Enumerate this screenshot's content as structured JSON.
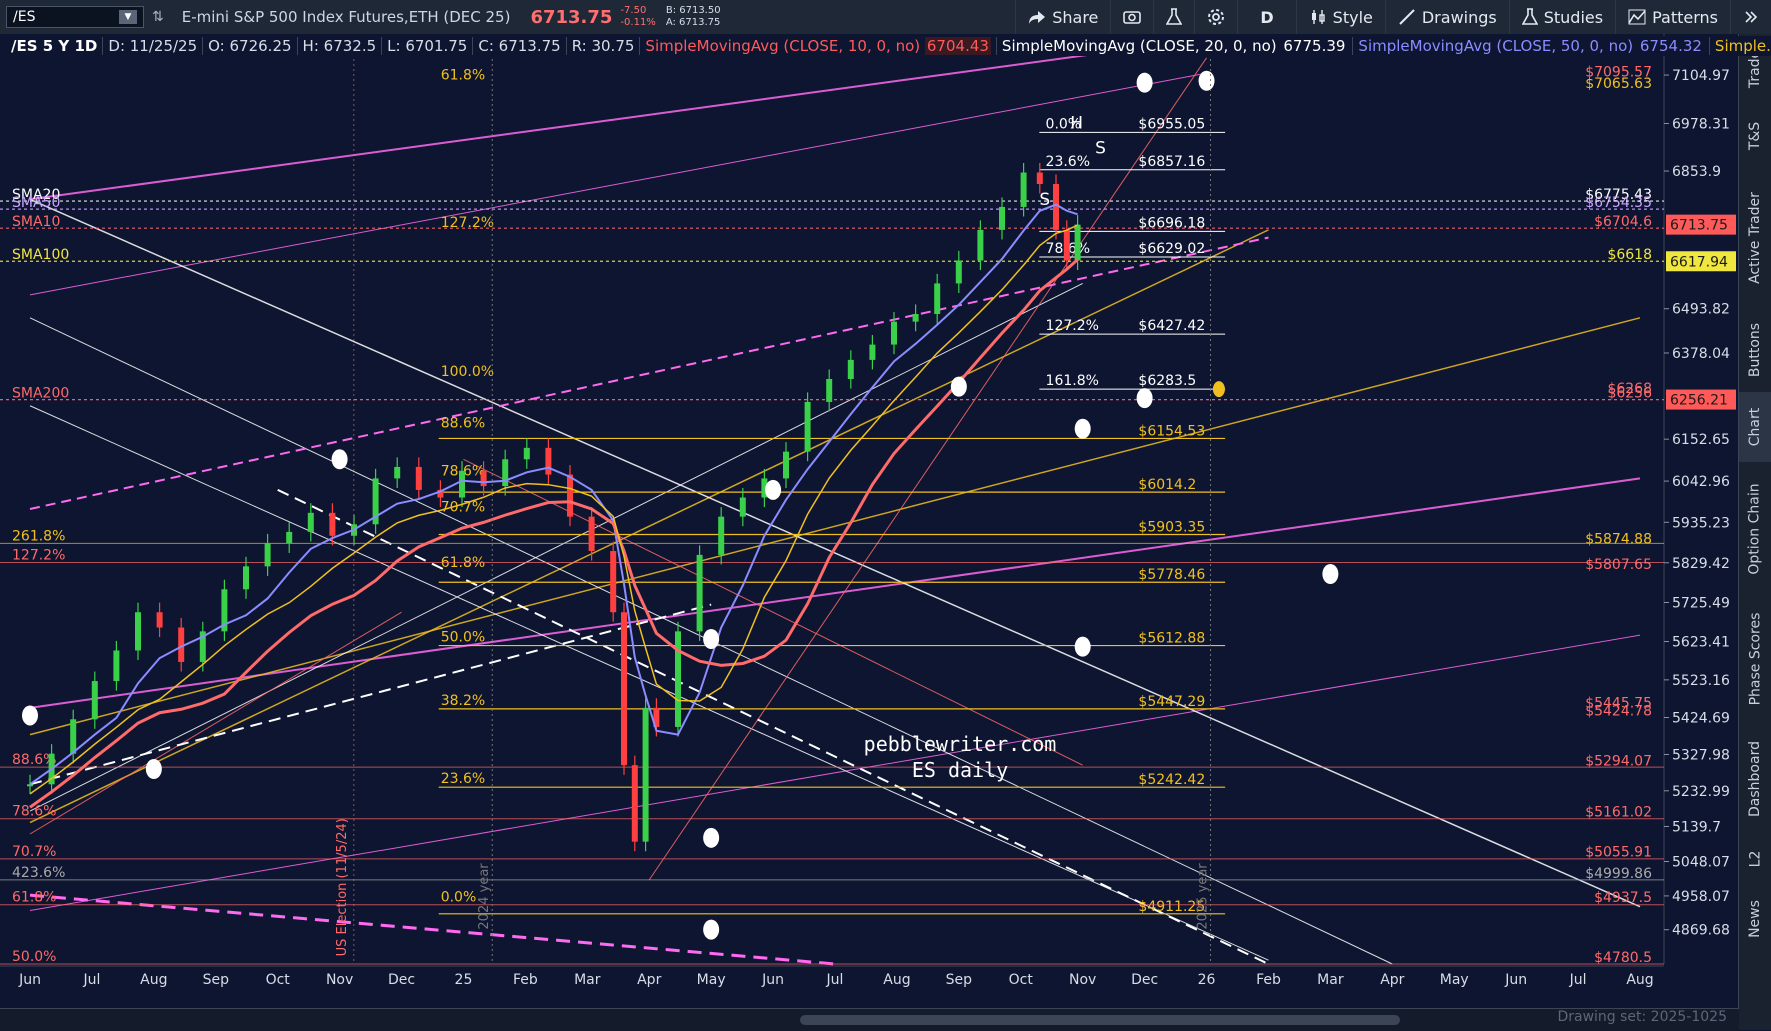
{
  "toolbar": {
    "symbol": "/ES",
    "description": "E-mini S&P 500 Index Futures,ETH (DEC 25)",
    "last": "6713.75",
    "change": "-7.50",
    "change_pct": "-0.11%",
    "bid": "B: 6713.50",
    "ask": "A: 6713.75",
    "share": "Share",
    "period": "D",
    "style": "Style",
    "drawings": "Drawings",
    "studies": "Studies",
    "patterns": "Patterns"
  },
  "legend": {
    "symbol": "/ES 5 Y 1D",
    "date": "D: 11/25/25",
    "open": "O: 6726.25",
    "high": "H: 6732.5",
    "low": "L: 6701.75",
    "close": "C: 6713.75",
    "range": "R: 30.75",
    "sma10": "SimpleMovingAvg (CLOSE, 10, 0, no)",
    "sma10_val": "6704.43",
    "sma20": "SimpleMovingAvg (CLOSE, 20, 0, no)",
    "sma20_val": "6775.39",
    "sma50": "SimpleMovingAvg (CLOSE, 50, 0, no)",
    "sma50_val": "6754.32",
    "more": "Simple..."
  },
  "sidebar": [
    "Trade",
    "T&S",
    "Active Trader",
    "Buttons",
    "Chart",
    "Option Chain",
    "Phase Scores",
    "Dashboard",
    "L2",
    "News"
  ],
  "watermark": {
    "line1": "pebblewriter.com",
    "line2": "ES daily"
  },
  "drawing_set": "Drawing set: 2025-1025",
  "chart_data": {
    "type": "candlestick",
    "ylim": [
      4780,
      7160
    ],
    "y_ticks": [
      7104.97,
      6978.31,
      6853.9,
      6493.82,
      6378.04,
      6152.65,
      6042.96,
      5935.23,
      5829.42,
      5725.49,
      5623.41,
      5523.16,
      5424.69,
      5327.98,
      5232.99,
      5139.7,
      5048.07,
      4958.07,
      4869.68
    ],
    "x_labels": [
      "Jun",
      "Jul",
      "Aug",
      "Sep",
      "Oct",
      "Nov",
      "Dec",
      "25",
      "Feb",
      "Mar",
      "Apr",
      "May",
      "Jun",
      "Jul",
      "Aug",
      "Sep",
      "Oct",
      "Nov",
      "Dec",
      "26",
      "Feb",
      "Mar",
      "Apr",
      "May",
      "Jun",
      "Jul",
      "Aug"
    ],
    "price_path": [
      [
        0,
        5250
      ],
      [
        20,
        5330
      ],
      [
        40,
        5420
      ],
      [
        60,
        5520
      ],
      [
        80,
        5600
      ],
      [
        100,
        5700
      ],
      [
        120,
        5660
      ],
      [
        140,
        5570
      ],
      [
        160,
        5650
      ],
      [
        180,
        5760
      ],
      [
        200,
        5820
      ],
      [
        220,
        5880
      ],
      [
        240,
        5910
      ],
      [
        260,
        5960
      ],
      [
        280,
        5900
      ],
      [
        300,
        5930
      ],
      [
        320,
        6050
      ],
      [
        340,
        6080
      ],
      [
        360,
        6020
      ],
      [
        380,
        6000
      ],
      [
        400,
        6070
      ],
      [
        420,
        6030
      ],
      [
        440,
        6100
      ],
      [
        460,
        6130
      ],
      [
        480,
        6060
      ],
      [
        500,
        5950
      ],
      [
        520,
        5860
      ],
      [
        540,
        5700
      ],
      [
        550,
        5300
      ],
      [
        560,
        5100
      ],
      [
        570,
        5450
      ],
      [
        580,
        5400
      ],
      [
        600,
        5650
      ],
      [
        620,
        5850
      ],
      [
        640,
        5950
      ],
      [
        660,
        6000
      ],
      [
        680,
        6050
      ],
      [
        700,
        6120
      ],
      [
        720,
        6250
      ],
      [
        740,
        6310
      ],
      [
        760,
        6360
      ],
      [
        780,
        6400
      ],
      [
        800,
        6460
      ],
      [
        820,
        6480
      ],
      [
        840,
        6560
      ],
      [
        860,
        6620
      ],
      [
        880,
        6700
      ],
      [
        900,
        6760
      ],
      [
        920,
        6850
      ],
      [
        935,
        6820
      ],
      [
        950,
        6700
      ],
      [
        960,
        6620
      ],
      [
        970,
        6713.75
      ]
    ],
    "sma_labels": [
      {
        "text": "SMA20",
        "color": "#ffffff",
        "value": 6775.39
      },
      {
        "text": "SMA50",
        "color": "#c9a3ff",
        "value": 6754.32
      },
      {
        "text": "SMA10",
        "color": "#ff6a6a",
        "value": 6704.43
      },
      {
        "text": "SMA100",
        "color": "#f0e640",
        "value": 6618
      },
      {
        "text": "SMA200",
        "color": "#ff6a6a",
        "value": 6256
      }
    ],
    "fib_levels_left": [
      {
        "text": "61.8%",
        "value": 7085,
        "color": "#f0c020"
      },
      {
        "text": "127.2%",
        "value": 6700,
        "color": "#f0c020"
      },
      {
        "text": "100.0%",
        "value": 6310,
        "color": "#f0c020"
      },
      {
        "text": "88.6%",
        "value": 6175,
        "color": "#f0c020"
      },
      {
        "text": "78.6%",
        "value": 6050,
        "color": "#f0c020"
      },
      {
        "text": "70.7%",
        "value": 5955,
        "color": "#f0c020"
      },
      {
        "text": "61.8%",
        "value": 5810,
        "color": "#f0c020"
      },
      {
        "text": "50.0%",
        "value": 5615,
        "color": "#f0c020"
      },
      {
        "text": "38.2%",
        "value": 5450,
        "color": "#f0c020"
      },
      {
        "text": "23.6%",
        "value": 5245,
        "color": "#f0c020"
      },
      {
        "text": "0.0%",
        "value": 4935,
        "color": "#f0c020"
      }
    ],
    "fib_values_mid": [
      {
        "text": "$6154.53",
        "value": 6154.53
      },
      {
        "text": "$6014.2",
        "value": 6014.2
      },
      {
        "text": "$5903.35",
        "value": 5903.35
      },
      {
        "text": "$5778.46",
        "value": 5778.46
      },
      {
        "text": "$5612.88",
        "value": 5612.88
      },
      {
        "text": "$5447.29",
        "value": 5447.29
      },
      {
        "text": "$5242.42",
        "value": 5242.42
      },
      {
        "text": "$4911.25",
        "value": 4911.25
      }
    ],
    "fib_upper": [
      {
        "pct": "0.0%",
        "val": "$6955.05",
        "value": 6955.05
      },
      {
        "pct": "23.6%",
        "val": "$6857.16",
        "value": 6857.16
      },
      {
        "pct": "",
        "val": "$6696.18",
        "value": 6696.18
      },
      {
        "pct": "78.6%",
        "val": "$6629.02",
        "value": 6629.02
      },
      {
        "pct": "127.2%",
        "val": "$6427.42",
        "value": 6427.42
      },
      {
        "pct": "161.8%",
        "val": "$6283.5",
        "value": 6283.5
      }
    ],
    "far_left_levels": [
      {
        "text": "261.8%",
        "value": 5880,
        "color": "#f0c020"
      },
      {
        "text": "127.2%",
        "value": 5830,
        "color": "#ff6a6a"
      },
      {
        "text": "88.6%",
        "value": 5295,
        "color": "#ff6a6a"
      },
      {
        "text": "78.6%",
        "value": 5160,
        "color": "#ff6a6a"
      },
      {
        "text": "70.7%",
        "value": 5055,
        "color": "#ff6a6a"
      },
      {
        "text": "423.6%",
        "value": 5000,
        "color": "#aaaaaa"
      },
      {
        "text": "61.8%",
        "value": 4935,
        "color": "#ff6a6a"
      },
      {
        "text": "50.0%",
        "value": 4780,
        "color": "#ff6a6a"
      }
    ],
    "right_levels": [
      {
        "text": "$7095.57",
        "value": 7095.57,
        "color": "#ff6a6a"
      },
      {
        "text": "$7065.63",
        "value": 7065.63,
        "color": "#f0c020"
      },
      {
        "text": "$6775.43",
        "value": 6775.43,
        "color": "#ffffff"
      },
      {
        "text": "$6754.35",
        "value": 6754.35,
        "color": "#c9a3ff"
      },
      {
        "text": "$6704.6",
        "value": 6704.6,
        "color": "#ff6a6a"
      },
      {
        "text": "$6618",
        "value": 6618,
        "color": "#f0e640"
      },
      {
        "text": "$6268",
        "value": 6268,
        "color": "#ff6a6a"
      },
      {
        "text": "$6256",
        "value": 6256,
        "color": "#ff6a6a"
      },
      {
        "text": "$5874.88",
        "value": 5874.88,
        "color": "#f0c020"
      },
      {
        "text": "$5807.65",
        "value": 5807.65,
        "color": "#ff6a6a"
      },
      {
        "text": "$5445.75",
        "value": 5445.75,
        "color": "#ff6a6a"
      },
      {
        "text": "$5424.78",
        "value": 5424.78,
        "color": "#ff6a6a"
      },
      {
        "text": "$5294.07",
        "value": 5294.07,
        "color": "#ff6a6a"
      },
      {
        "text": "$5161.02",
        "value": 5161.02,
        "color": "#ff6a6a"
      },
      {
        "text": "$5055.91",
        "value": 5055.91,
        "color": "#ff6a6a"
      },
      {
        "text": "$4999.86",
        "value": 4999.86,
        "color": "#aaaaaa"
      },
      {
        "text": "$4937.5",
        "value": 4937.5,
        "color": "#ff6a6a"
      },
      {
        "text": "$4780.5",
        "value": 4780.5,
        "color": "#ff6a6a"
      }
    ],
    "price_badges": [
      {
        "text": "6713.75",
        "value": 6713.75,
        "bg": "#ff5a5a",
        "fg": "#1a1a1a"
      },
      {
        "text": "6617.94",
        "value": 6617.94,
        "bg": "#f0e640",
        "fg": "#1a1a1a"
      },
      {
        "text": "6256.21",
        "value": 6256.21,
        "bg": "#ff5a5a",
        "fg": "#1a1a1a"
      }
    ],
    "annotations": [
      {
        "text": "US Election (11/5/24)"
      },
      {
        "text": "2024 year"
      },
      {
        "text": "2025 year"
      }
    ],
    "hs_labels": [
      "H",
      "S",
      "S"
    ]
  }
}
